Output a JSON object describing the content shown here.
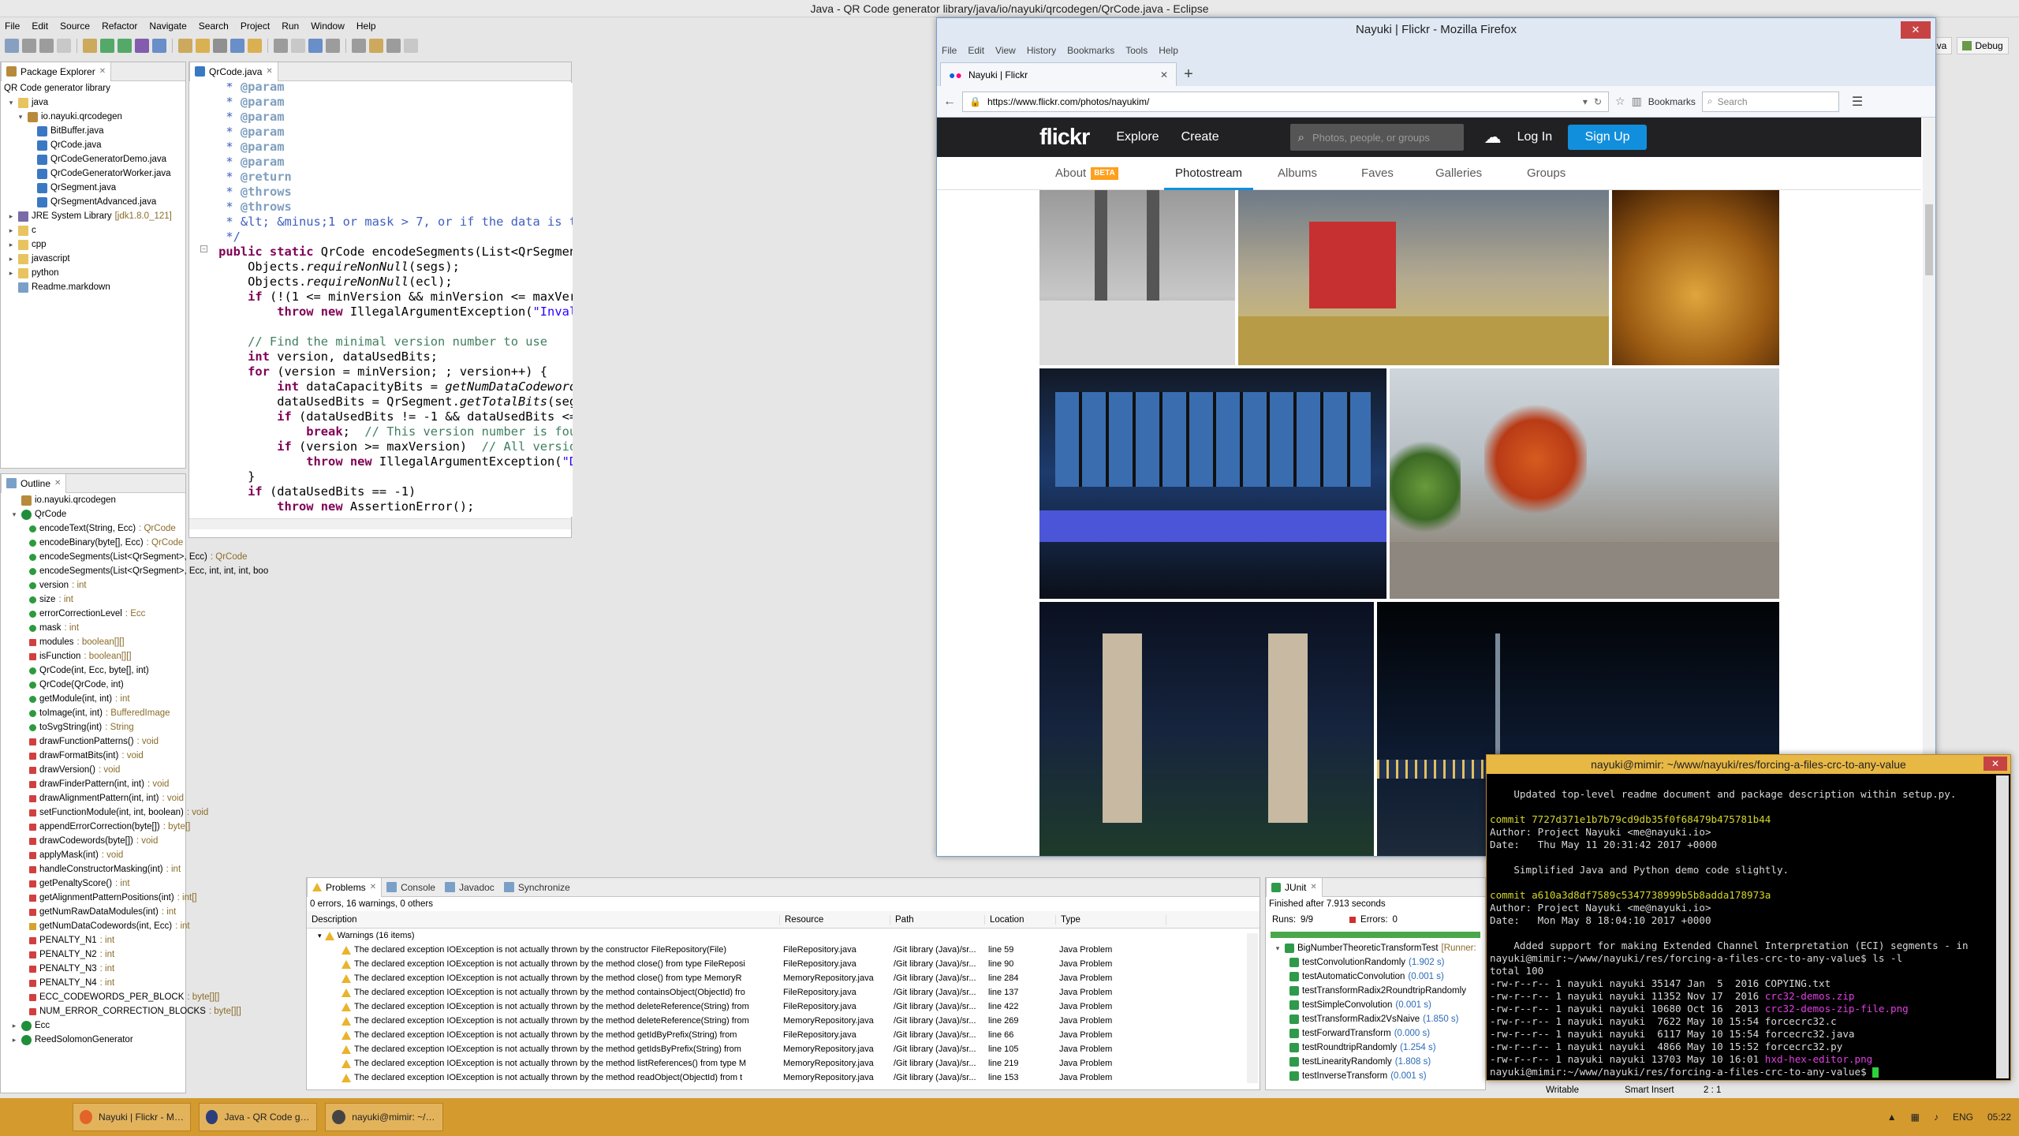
{
  "eclipse": {
    "title": "Java - QR Code generator library/java/io/nayuki/qrcodegen/QrCode.java - Eclipse",
    "menu": [
      "File",
      "Edit",
      "Source",
      "Refactor",
      "Navigate",
      "Search",
      "Project",
      "Run",
      "Window",
      "Help"
    ],
    "perspectives": [
      "Java",
      "Debug"
    ],
    "package_explorer": {
      "tab": "Package Explorer",
      "root": "QR Code generator library",
      "items": [
        {
          "label": "java",
          "indent": 1,
          "icon": "folder"
        },
        {
          "label": "io.nayuki.qrcodegen",
          "indent": 2,
          "icon": "pkg"
        },
        {
          "label": "BitBuffer.java",
          "indent": 3,
          "icon": "java"
        },
        {
          "label": "QrCode.java",
          "indent": 3,
          "icon": "java"
        },
        {
          "label": "QrCodeGeneratorDemo.java",
          "indent": 3,
          "icon": "java"
        },
        {
          "label": "QrCodeGeneratorWorker.java",
          "indent": 3,
          "icon": "java"
        },
        {
          "label": "QrSegment.java",
          "indent": 3,
          "icon": "java"
        },
        {
          "label": "QrSegmentAdvanced.java",
          "indent": 3,
          "icon": "java"
        },
        {
          "label": "JRE System Library",
          "extra": "[jdk1.8.0_121]",
          "indent": 1,
          "icon": "lib"
        },
        {
          "label": "c",
          "indent": 1,
          "icon": "folder"
        },
        {
          "label": "cpp",
          "indent": 1,
          "icon": "folder"
        },
        {
          "label": "javascript",
          "indent": 1,
          "icon": "folder"
        },
        {
          "label": "python",
          "indent": 1,
          "icon": "folder"
        },
        {
          "label": "Readme.markdown",
          "indent": 1,
          "icon": "md"
        }
      ]
    },
    "outline": {
      "tab": "Outline",
      "items": [
        {
          "label": "io.nayuki.qrcodegen",
          "indent": 1,
          "icon": "pkg",
          "type": ""
        },
        {
          "label": "QrCode",
          "indent": 1,
          "icon": "cls",
          "type": ""
        },
        {
          "label": "encodeText(String, Ecc)",
          "type": " : QrCode",
          "icon": "m-pub"
        },
        {
          "label": "encodeBinary(byte[], Ecc)",
          "type": " : QrCode",
          "icon": "m-pub"
        },
        {
          "label": "encodeSegments(List<QrSegment>, Ecc)",
          "type": " : QrCode",
          "icon": "m-pub"
        },
        {
          "label": "encodeSegments(List<QrSegment>, Ecc, int, int, int, boo",
          "type": "",
          "icon": "m-pub"
        },
        {
          "label": "version",
          "type": " : int",
          "icon": "f-pub"
        },
        {
          "label": "size",
          "type": " : int",
          "icon": "f-pub"
        },
        {
          "label": "errorCorrectionLevel",
          "type": " : Ecc",
          "icon": "f-pub"
        },
        {
          "label": "mask",
          "type": " : int",
          "icon": "f-pub"
        },
        {
          "label": "modules",
          "type": " : boolean[][]",
          "icon": "m-priv"
        },
        {
          "label": "isFunction",
          "type": " : boolean[][]",
          "icon": "m-priv"
        },
        {
          "label": "QrCode(int, Ecc, byte[], int)",
          "type": "",
          "icon": "m-pub"
        },
        {
          "label": "QrCode(QrCode, int)",
          "type": "",
          "icon": "m-pub"
        },
        {
          "label": "getModule(int, int)",
          "type": " : int",
          "icon": "m-pub"
        },
        {
          "label": "toImage(int, int)",
          "type": " : BufferedImage",
          "icon": "m-pub"
        },
        {
          "label": "toSvgString(int)",
          "type": " : String",
          "icon": "m-pub"
        },
        {
          "label": "drawFunctionPatterns()",
          "type": " : void",
          "icon": "m-priv"
        },
        {
          "label": "drawFormatBits(int)",
          "type": " : void",
          "icon": "m-priv"
        },
        {
          "label": "drawVersion()",
          "type": " : void",
          "icon": "m-priv"
        },
        {
          "label": "drawFinderPattern(int, int)",
          "type": " : void",
          "icon": "m-priv"
        },
        {
          "label": "drawAlignmentPattern(int, int)",
          "type": " : void",
          "icon": "m-priv"
        },
        {
          "label": "setFunctionModule(int, int, boolean)",
          "type": " : void",
          "icon": "m-priv"
        },
        {
          "label": "appendErrorCorrection(byte[])",
          "type": " : byte[]",
          "icon": "m-priv"
        },
        {
          "label": "drawCodewords(byte[])",
          "type": " : void",
          "icon": "m-priv"
        },
        {
          "label": "applyMask(int)",
          "type": " : void",
          "icon": "m-priv"
        },
        {
          "label": "handleConstructorMasking(int)",
          "type": " : int",
          "icon": "m-priv"
        },
        {
          "label": "getPenaltyScore()",
          "type": " : int",
          "icon": "m-priv"
        },
        {
          "label": "getAlignmentPatternPositions(int)",
          "type": " : int[]",
          "icon": "m-priv"
        },
        {
          "label": "getNumRawDataModules(int)",
          "type": " : int",
          "icon": "m-priv"
        },
        {
          "label": "getNumDataCodewords(int, Ecc)",
          "type": " : int",
          "icon": "m-prot"
        },
        {
          "label": "PENALTY_N1",
          "type": " : int",
          "icon": "m-priv"
        },
        {
          "label": "PENALTY_N2",
          "type": " : int",
          "icon": "m-priv"
        },
        {
          "label": "PENALTY_N3",
          "type": " : int",
          "icon": "m-priv"
        },
        {
          "label": "PENALTY_N4",
          "type": " : int",
          "icon": "m-priv"
        },
        {
          "label": "ECC_CODEWORDS_PER_BLOCK",
          "type": " : byte[][]",
          "icon": "m-priv"
        },
        {
          "label": "NUM_ERROR_CORRECTION_BLOCKS",
          "type": " : byte[][]",
          "icon": "m-priv"
        },
        {
          "label": "Ecc",
          "indent": 1,
          "icon": "cls",
          "type": ""
        },
        {
          "label": "ReedSolomonGenerator",
          "indent": 1,
          "icon": "cls",
          "type": ""
        }
      ]
    },
    "editor": {
      "tab": "QrCode.java"
    },
    "problems": {
      "tabs": [
        "Problems",
        "Console",
        "Javadoc",
        "Synchronize"
      ],
      "summary": "0 errors, 16 warnings, 0 others",
      "columns": [
        "Description",
        "Resource",
        "Path",
        "Location",
        "Type"
      ],
      "group": "Warnings (16 items)",
      "rows": [
        [
          "The declared exception IOException is not actually thrown by the constructor FileRepository(File)",
          "FileRepository.java",
          "/Git library (Java)/sr...",
          "line 59",
          "Java Problem"
        ],
        [
          "The declared exception IOException is not actually thrown by the method close() from type FileReposi",
          "FileRepository.java",
          "/Git library (Java)/sr...",
          "line 90",
          "Java Problem"
        ],
        [
          "The declared exception IOException is not actually thrown by the method close() from type MemoryR",
          "MemoryRepository.java",
          "/Git library (Java)/sr...",
          "line 284",
          "Java Problem"
        ],
        [
          "The declared exception IOException is not actually thrown by the method containsObject(ObjectId) fro",
          "FileRepository.java",
          "/Git library (Java)/sr...",
          "line 137",
          "Java Problem"
        ],
        [
          "The declared exception IOException is not actually thrown by the method deleteReference(String) from",
          "FileRepository.java",
          "/Git library (Java)/sr...",
          "line 422",
          "Java Problem"
        ],
        [
          "The declared exception IOException is not actually thrown by the method deleteReference(String) from",
          "MemoryRepository.java",
          "/Git library (Java)/sr...",
          "line 269",
          "Java Problem"
        ],
        [
          "The declared exception IOException is not actually thrown by the method getIdByPrefix(String) from",
          "FileRepository.java",
          "/Git library (Java)/sr...",
          "line 66",
          "Java Problem"
        ],
        [
          "The declared exception IOException is not actually thrown by the method getIdsByPrefix(String) from",
          "MemoryRepository.java",
          "/Git library (Java)/sr...",
          "line 105",
          "Java Problem"
        ],
        [
          "The declared exception IOException is not actually thrown by the method listReferences() from type M",
          "MemoryRepository.java",
          "/Git library (Java)/sr...",
          "line 219",
          "Java Problem"
        ],
        [
          "The declared exception IOException is not actually thrown by the method readObject(ObjectId) from t",
          "MemoryRepository.java",
          "/Git library (Java)/sr...",
          "line 153",
          "Java Problem"
        ]
      ]
    },
    "junit": {
      "tab": "JUnit",
      "finished": "Finished after 7.913 seconds",
      "runs_label": "Runs:",
      "runs": "9/9",
      "errors_label": "Errors:",
      "errors": "0",
      "suite": "BigNumberTheoreticTransformTest",
      "suite_extra": "[Runner:",
      "tests": [
        {
          "name": "testConvolutionRandomly",
          "time": "(1.902 s)"
        },
        {
          "name": "testAutomaticConvolution",
          "time": "(0.001 s)"
        },
        {
          "name": "testTransformRadix2RoundtripRandomly",
          "time": ""
        },
        {
          "name": "testSimpleConvolution",
          "time": "(0.001 s)"
        },
        {
          "name": "testTransformRadix2VsNaive",
          "time": "(1.850 s)"
        },
        {
          "name": "testForwardTransform",
          "time": "(0.000 s)"
        },
        {
          "name": "testRoundtripRandomly",
          "time": "(1.254 s)"
        },
        {
          "name": "testLinearityRandomly",
          "time": "(1.808 s)"
        },
        {
          "name": "testInverseTransform",
          "time": "(0.001 s)"
        }
      ]
    },
    "status": {
      "writable": "Writable",
      "insert": "Smart Insert",
      "position": "2 : 1"
    }
  },
  "firefox": {
    "title": "Nayuki | Flickr - Mozilla Firefox",
    "menu": [
      "File",
      "Edit",
      "View",
      "History",
      "Bookmarks",
      "Tools",
      "Help"
    ],
    "tab_title": "Nayuki | Flickr",
    "url": "https://www.flickr.com/photos/nayukim/",
    "bookmarks_label": "Bookmarks",
    "search_placeholder": "Search"
  },
  "flickr": {
    "logo": "flickr",
    "nav": [
      "Explore",
      "Create"
    ],
    "search_placeholder": "Photos, people, or groups",
    "login": "Log In",
    "signup": "Sign Up",
    "subnav": [
      "About",
      "Photostream",
      "Albums",
      "Faves",
      "Galleries",
      "Groups"
    ],
    "beta": "BETA"
  },
  "terminal": {
    "title": "nayuki@mimir: ~/www/nayuki/res/forcing-a-files-crc-to-any-value",
    "lines": [
      {
        "t": "",
        "c": ""
      },
      {
        "t": "    Updated top-level readme document and package description within setup.py.",
        "c": ""
      },
      {
        "t": "",
        "c": ""
      },
      {
        "t": "commit 7727d371e1b7b79cd9db35f0f68479b475781b44",
        "c": "y"
      },
      {
        "t": "Author: Project Nayuki <me@nayuki.io>",
        "c": ""
      },
      {
        "t": "Date:   Thu May 11 20:31:42 2017 +0000",
        "c": ""
      },
      {
        "t": "",
        "c": ""
      },
      {
        "t": "    Simplified Java and Python demo code slightly.",
        "c": ""
      },
      {
        "t": "",
        "c": ""
      },
      {
        "t": "commit a610a3d8df7589c5347738999b5b8adda178973a",
        "c": "y"
      },
      {
        "t": "Author: Project Nayuki <me@nayuki.io>",
        "c": ""
      },
      {
        "t": "Date:   Mon May 8 18:04:10 2017 +0000",
        "c": ""
      },
      {
        "t": "",
        "c": ""
      },
      {
        "t": "    Added support for making Extended Channel Interpretation (ECI) segments - in",
        "c": ""
      },
      {
        "t": "nayuki@mimir:~/www/nayuki/res/forcing-a-files-crc-to-any-value$ ls -l",
        "c": ""
      },
      {
        "t": "total 100",
        "c": ""
      },
      {
        "t": "-rw-r--r-- 1 nayuki nayuki 35147 Jan  5  2016 COPYING.txt",
        "c": ""
      },
      {
        "t": "-rw-r--r-- 1 nayuki nayuki 11352 Nov 17  2016 ",
        "c": "",
        "m": "crc32-demos.zip"
      },
      {
        "t": "-rw-r--r-- 1 nayuki nayuki 10680 Oct 16  2013 ",
        "c": "",
        "m": "crc32-demos-zip-file.png"
      },
      {
        "t": "-rw-r--r-- 1 nayuki nayuki  7622 May 10 15:54 forcecrc32.c",
        "c": ""
      },
      {
        "t": "-rw-r--r-- 1 nayuki nayuki  6117 May 10 15:54 forcecrc32.java",
        "c": ""
      },
      {
        "t": "-rw-r--r-- 1 nayuki nayuki  4866 May 10 15:52 forcecrc32.py",
        "c": ""
      },
      {
        "t": "-rw-r--r-- 1 nayuki nayuki 13703 May 10 16:01 ",
        "c": "",
        "m": "hxd-hex-editor.png"
      },
      {
        "t": "nayuki@mimir:~/www/nayuki/res/forcing-a-files-crc-to-any-value$ ",
        "c": "",
        "cursor": true
      }
    ]
  },
  "taskbar": {
    "items": [
      {
        "label": "Nayuki | Flickr - Mozi...",
        "color": "#e2642b"
      },
      {
        "label": "Java - QR Code gene...",
        "color": "#2c3e7c"
      },
      {
        "label": "nayuki@mimir: ~/w...",
        "color": "#444444"
      }
    ],
    "lang": "ENG",
    "time": "05:22"
  }
}
